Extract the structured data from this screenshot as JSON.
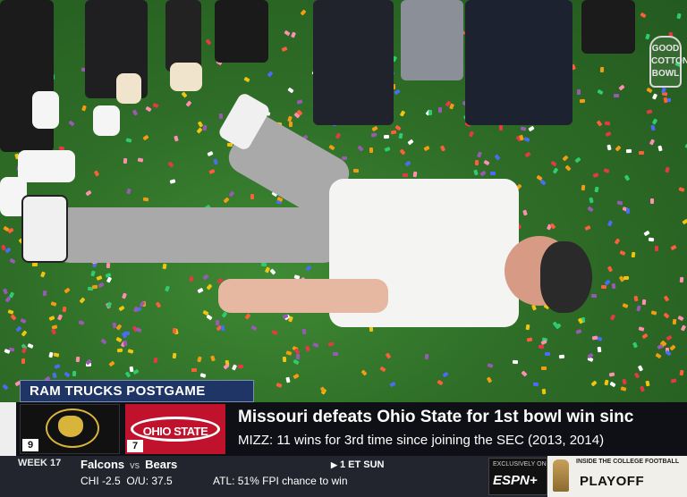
{
  "scene": {
    "corner_bug_text": "GOOD COTTON BOWL"
  },
  "lower_third": {
    "sponsor_label": "RAM TRUCKS POSTGAME",
    "team_left": {
      "name": "Missouri",
      "seed": "9"
    },
    "team_right": {
      "name": "OHIO STATE",
      "seed": "7"
    },
    "headline": "Missouri defeats Ohio State for 1st bowl win sinc",
    "subline": "MIZZ: 11 wins for 3rd time since joining the SEC (2013, 2014)"
  },
  "ticker": {
    "week": "WEEK 17",
    "team_a": "Falcons",
    "vs": "vs",
    "team_b": "Bears",
    "line_a": "CHI -2.5",
    "ou": "O/U: 37.5",
    "fpi": "ATL: 51% FPI chance to win",
    "time": "1 ET SUN",
    "espn_exclusive": "EXCLUSIVELY ON",
    "espn_logo": "ESPN+",
    "playoff_small": "INSIDE THE COLLEGE FOOTBALL",
    "playoff_big": "PLAYOFF"
  },
  "colors": {
    "field": "#2e6d27",
    "postgame_bg": "#1f3566",
    "ohio_red": "#c0112d",
    "mizzou_gold": "#d8b53a"
  }
}
